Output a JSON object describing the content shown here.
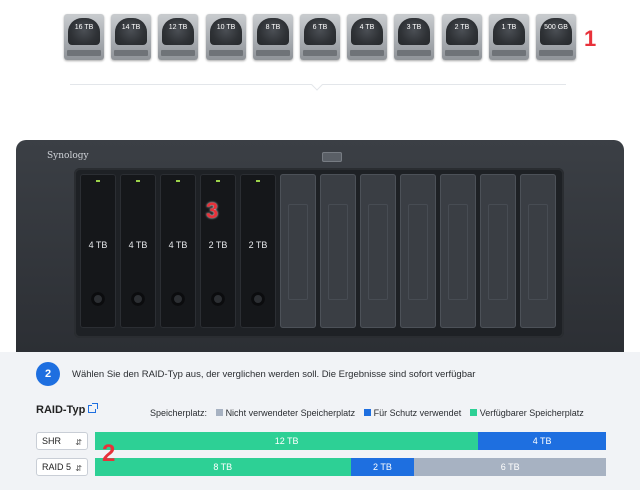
{
  "drive_picker": {
    "drives": [
      "16 TB",
      "14 TB",
      "12 TB",
      "10 TB",
      "8 TB",
      "6 TB",
      "4 TB",
      "3 TB",
      "2 TB",
      "1 TB",
      "500 GB"
    ],
    "annotation": "1"
  },
  "nas": {
    "brand": "Synology",
    "bays": [
      {
        "label": "4 TB",
        "filled": true
      },
      {
        "label": "4 TB",
        "filled": true
      },
      {
        "label": "4 TB",
        "filled": true
      },
      {
        "label": "2 TB",
        "filled": true
      },
      {
        "label": "2 TB",
        "filled": true
      },
      {
        "label": "",
        "filled": false
      },
      {
        "label": "",
        "filled": false
      },
      {
        "label": "",
        "filled": false
      },
      {
        "label": "",
        "filled": false
      },
      {
        "label": "",
        "filled": false
      },
      {
        "label": "",
        "filled": false
      },
      {
        "label": "",
        "filled": false
      }
    ],
    "annotation": "3"
  },
  "panel": {
    "step": "2",
    "instruction": "Wählen Sie den RAID-Typ aus, der verglichen werden soll. Die Ergebnisse sind sofort verfügbar",
    "raid_title": "RAID-Typ",
    "legend": {
      "label": "Speicherplatz:",
      "items": [
        {
          "label": "Nicht verwendeter Speicherplatz",
          "color": "#a7b2c2"
        },
        {
          "label": "Für Schutz verwendet",
          "color": "#1e6fe0"
        },
        {
          "label": "Verfügbarer Speicherplatz",
          "color": "#2dd095"
        }
      ]
    },
    "rows": [
      {
        "raid": "SHR",
        "segments": [
          {
            "label": "12 TB",
            "value": 12,
            "color": "#2dd095"
          },
          {
            "label": "4 TB",
            "value": 4,
            "color": "#1e6fe0"
          }
        ]
      },
      {
        "raid": "RAID 5",
        "segments": [
          {
            "label": "8 TB",
            "value": 8,
            "color": "#2dd095"
          },
          {
            "label": "2 TB",
            "value": 2,
            "color": "#1e6fe0"
          },
          {
            "label": "6 TB",
            "value": 6,
            "color": "#a7b2c2"
          }
        ]
      }
    ],
    "annotation": "2"
  }
}
